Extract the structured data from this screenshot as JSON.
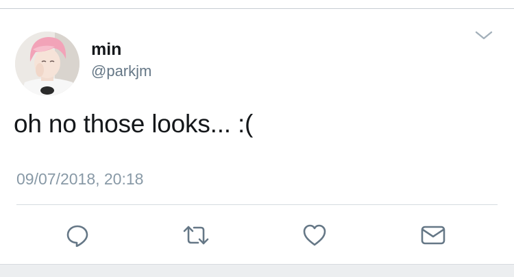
{
  "tweet": {
    "display_name": "min",
    "handle": "@parkjm",
    "text": "oh no those looks... :(",
    "timestamp": "09/07/2018, 20:18"
  },
  "icons": {
    "menu": "chevron-down-icon",
    "reply": "reply-icon",
    "retweet": "retweet-icon",
    "like": "heart-icon",
    "dm": "mail-icon"
  },
  "colors": {
    "text": "#14171a",
    "secondary": "#657786",
    "timestamp": "#8899a6",
    "icon": "#657786",
    "divider": "#d5dbe0",
    "avatar_hair": "#f2a3b8"
  }
}
